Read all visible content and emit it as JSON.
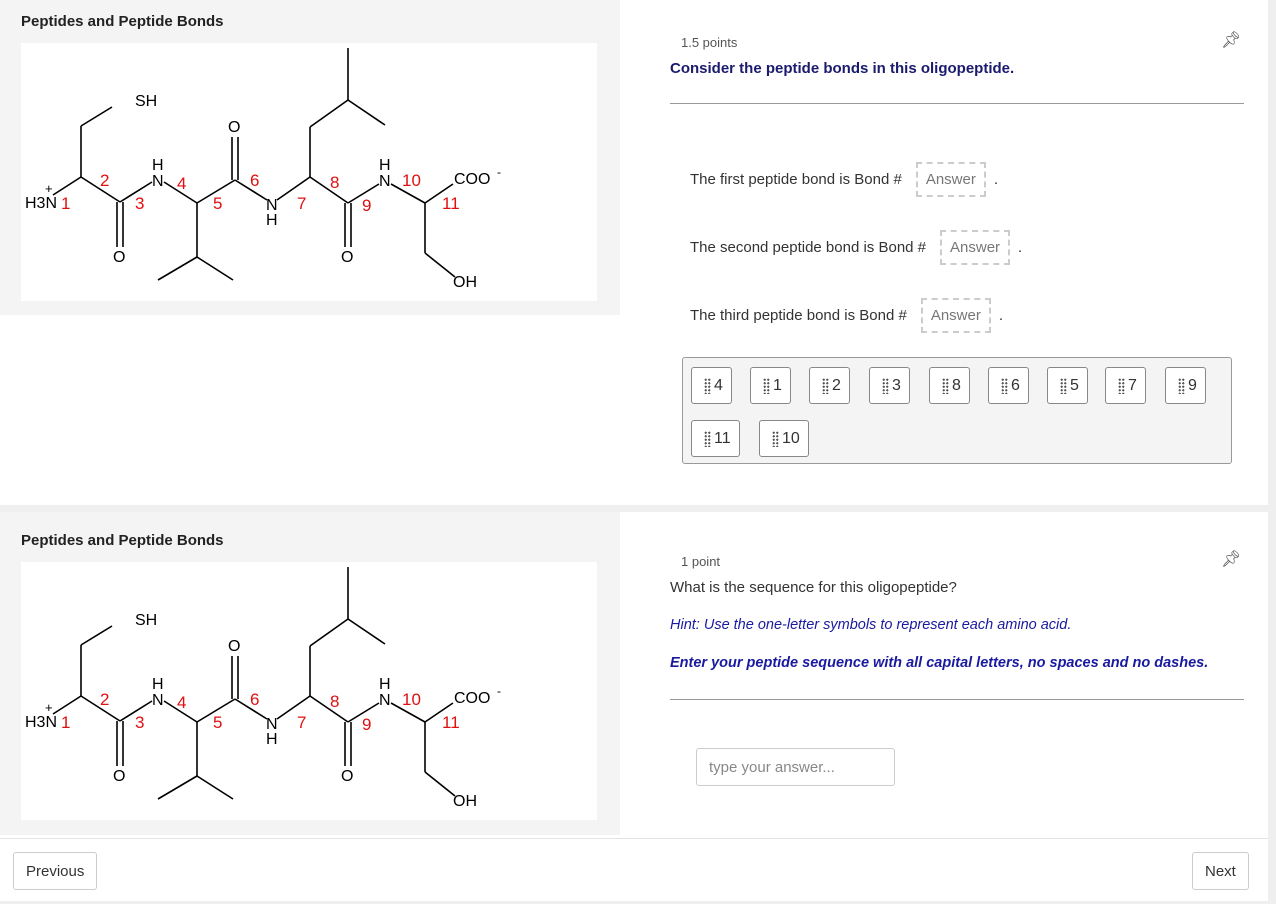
{
  "panel_title": "Peptides and Peptide Bonds",
  "molecule": {
    "atoms": {
      "h3n": "H3N",
      "plus": "+",
      "sh": "SH",
      "o": "O",
      "n": "N",
      "h": "H",
      "coo": "COO",
      "minus": "-",
      "oh": "OH"
    },
    "bond_numbers": [
      "1",
      "2",
      "3",
      "4",
      "5",
      "6",
      "7",
      "8",
      "9",
      "10",
      "11"
    ]
  },
  "question1": {
    "points": "1.5 points",
    "prompt": "Consider the peptide bonds in this oligopeptide.",
    "rows": [
      {
        "label": "The first peptide bond is Bond #",
        "placeholder": "Answer"
      },
      {
        "label": "The second peptide bond is Bond #",
        "placeholder": "Answer"
      },
      {
        "label": "The third peptide bond is Bond #",
        "placeholder": "Answer"
      }
    ],
    "choices": [
      "4",
      "1",
      "2",
      "3",
      "8",
      "6",
      "5",
      "7",
      "9",
      "11",
      "10"
    ],
    "pin_icon": "pin-icon"
  },
  "question2": {
    "points": "1 point",
    "prompt": "What is the sequence for this oligopeptide?",
    "hint": "Hint: Use the one-letter symbols to represent each amino acid.",
    "instruction": "Enter your peptide sequence with all capital letters, no spaces and no dashes.",
    "placeholder": "type your answer...",
    "pin_icon": "pin-icon"
  },
  "nav": {
    "previous": "Previous",
    "next": "Next"
  },
  "colors": {
    "prompt": "#1a1a6e",
    "hint": "#1a1aa0",
    "bond_number": "#e01010"
  }
}
